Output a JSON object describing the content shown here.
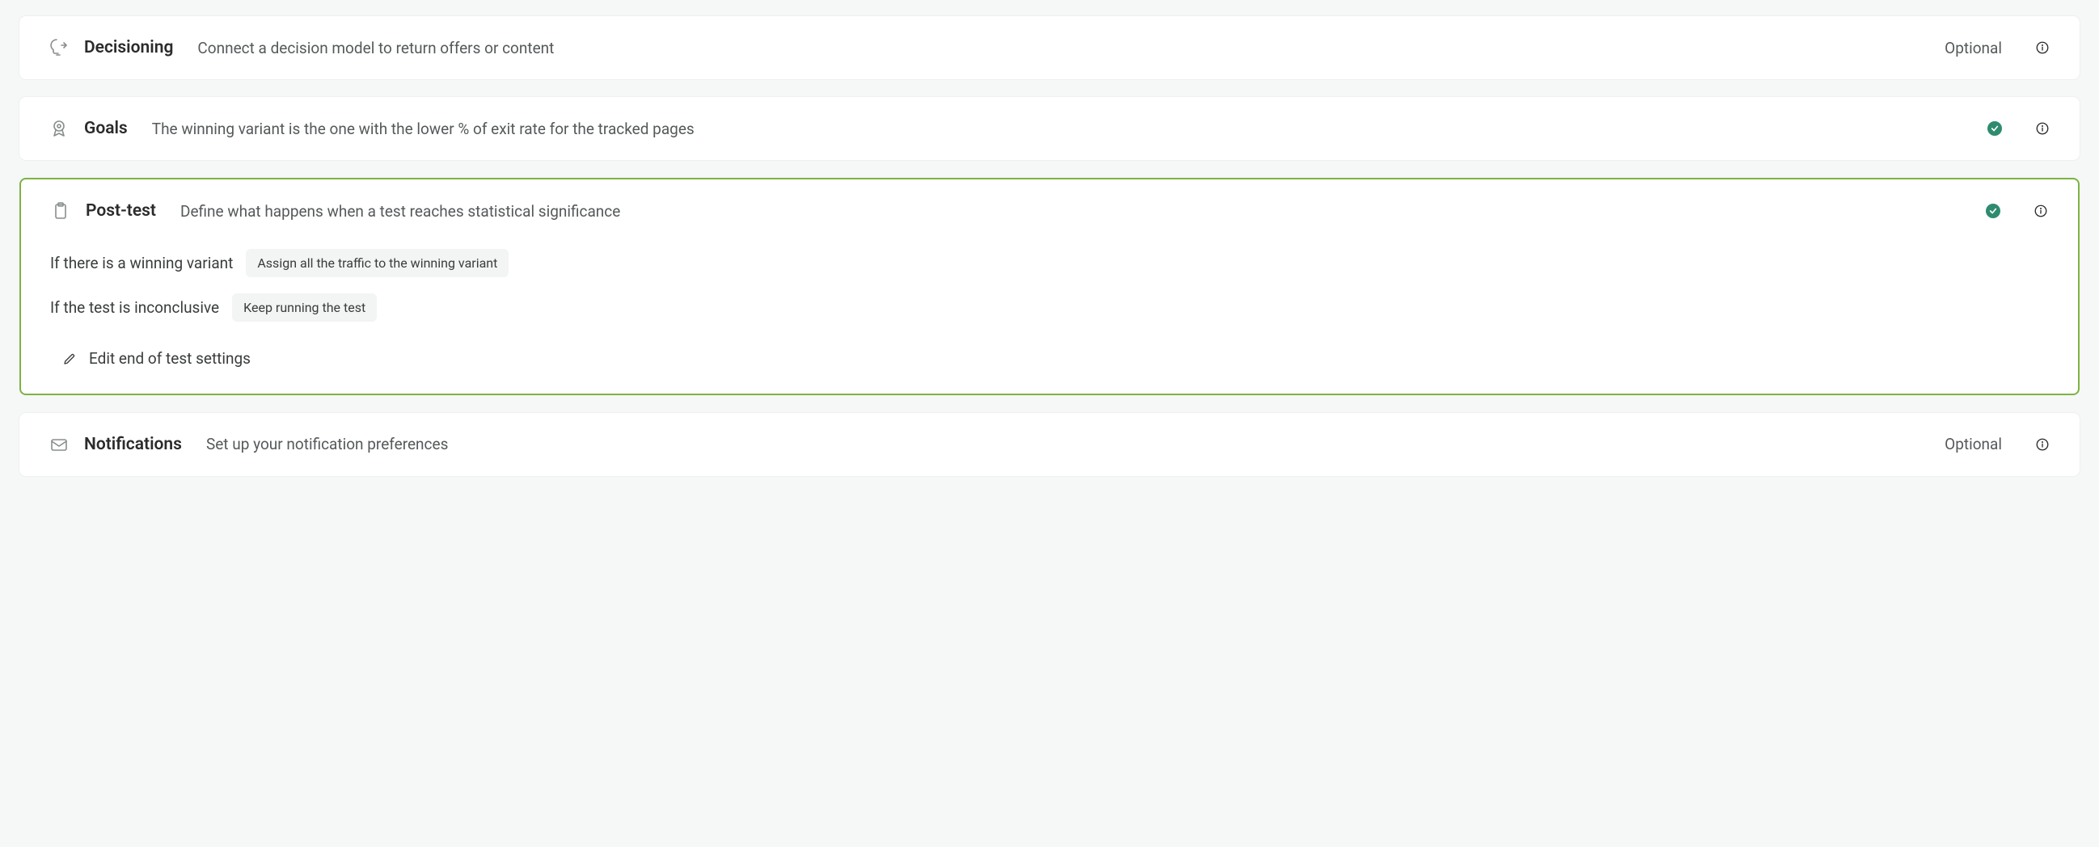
{
  "decisioning": {
    "title": "Decisioning",
    "desc": "Connect a decision model to return offers or content",
    "optional": "Optional"
  },
  "goals": {
    "title": "Goals",
    "desc": "The winning variant is the one with the lower % of exit rate for the tracked pages"
  },
  "posttest": {
    "title": "Post-test",
    "desc": "Define what happens when a test reaches statistical significance",
    "winning_label": "If there is a winning variant",
    "winning_value": "Assign all the traffic to the winning variant",
    "inconclusive_label": "If the test is inconclusive",
    "inconclusive_value": "Keep running the test",
    "edit_label": "Edit end of test settings"
  },
  "notifications": {
    "title": "Notifications",
    "desc": "Set up your notification preferences",
    "optional": "Optional"
  }
}
